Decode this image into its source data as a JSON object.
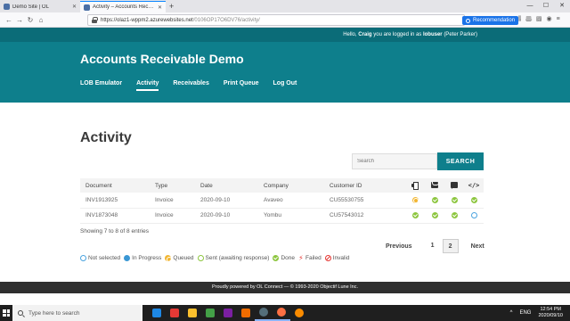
{
  "browser": {
    "tabs": [
      {
        "label": "Demo Site | OL",
        "active": false
      },
      {
        "label": "Activity – Accounts Receivable Demo",
        "active": true
      }
    ],
    "new_tab": "+",
    "url_host": "https://olaz1-wppm2.azurewebsites.net",
    "url_path": "/0106OP17O6DV76/activity/",
    "recommendation": "Recommendation"
  },
  "site": {
    "greeting_prefix": "Hello,",
    "user": "Craig",
    "greeting_mid": "you are logged in as",
    "login": "lobuser",
    "login_name": "(Peter Parker)",
    "title": "Accounts Receivable Demo",
    "nav": [
      "LOB Emulator",
      "Activity",
      "Receivables",
      "Print Queue",
      "Log Out"
    ],
    "nav_active": "Activity"
  },
  "main": {
    "title": "Activity",
    "search_placeholder": "Search",
    "search_button": "SEARCH",
    "columns": [
      "Document",
      "Type",
      "Date",
      "Company",
      "Customer ID"
    ],
    "icon_columns": [
      "printer-icon",
      "envelope-icon",
      "chat-icon",
      "code-icon"
    ],
    "rows": [
      {
        "document": "INV1913925",
        "type": "Invoice",
        "date": "2020-09-10",
        "company": "Avaveo",
        "customer_id": "CU55530755",
        "statuses": [
          "queued",
          "done",
          "done",
          "done"
        ]
      },
      {
        "document": "INV1873048",
        "type": "Invoice",
        "date": "2020-09-10",
        "company": "Yombu",
        "customer_id": "CU57543012",
        "statuses": [
          "done",
          "done",
          "done",
          "not-selected"
        ]
      }
    ],
    "entries": "Showing 7 to 8 of 8 entries",
    "pager": {
      "previous": "Previous",
      "pages": [
        "1",
        "2"
      ],
      "current": "2",
      "next": "Next"
    },
    "legend": [
      {
        "status": "not-selected",
        "label": "Not selected"
      },
      {
        "status": "in-progress",
        "label": "In Progress"
      },
      {
        "status": "queued",
        "label": "Queued"
      },
      {
        "status": "sent",
        "label": "Sent (awaiting response)"
      },
      {
        "status": "done",
        "label": "Done"
      },
      {
        "status": "failed",
        "label": "Failed"
      },
      {
        "status": "invalid",
        "label": "Invalid"
      }
    ]
  },
  "footer": "Proudly powered by OL Connect — © 1993-2020 Objectif Lune Inc.",
  "taskbar": {
    "search_placeholder": "Type here to search",
    "lang": "ENG",
    "time": "12:54 PM",
    "date": "2020/09/10",
    "app_colors": [
      "#1e88e5",
      "#e53935",
      "#fbc02d",
      "#43a047",
      "#7b1fa2",
      "#ef6c00",
      "#546e7a",
      "#ff7043",
      "#fb8c00"
    ]
  },
  "colors": {
    "teal": "#0e7f8c",
    "teal_dark": "#0b6c78",
    "done": "#8dc63f",
    "queued": "#f2b632",
    "failed": "#e53935",
    "progress": "#3a97d4"
  }
}
